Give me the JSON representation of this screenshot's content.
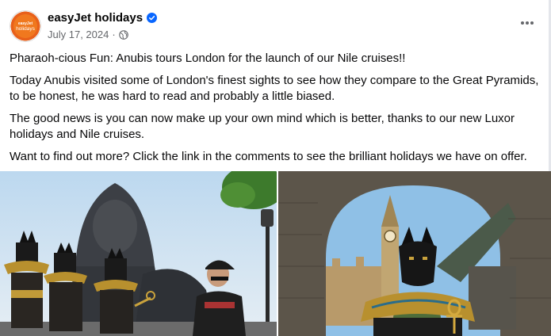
{
  "page": {
    "name": "easyJet holidays",
    "date": "July 17, 2024",
    "separator": "·",
    "avatar_text_top": "easyJet",
    "avatar_text_bottom": "holidays"
  },
  "post": {
    "paragraphs": [
      "Pharaoh-cious Fun: Anubis tours London for the launch of our Nile cruises!!",
      "Today Anubis visited some of London's finest sights to see how they compare to the Great Pyramids, to be honest, he was hard to read and probably a little biased.",
      "The good news is you can now make up your own mind which is better, thanks to our new Luxor holidays and Nile cruises.",
      "Want to find out more? Click the link in the comments to see the brilliant holidays we have on offer."
    ]
  },
  "icons": {
    "verified": "verified-badge-icon",
    "audience": "globe-icon",
    "more": "more-options-icon"
  },
  "colors": {
    "brand_orange": "#f0781e",
    "verified_blue": "#0866ff",
    "meta_gray": "#65676b"
  }
}
